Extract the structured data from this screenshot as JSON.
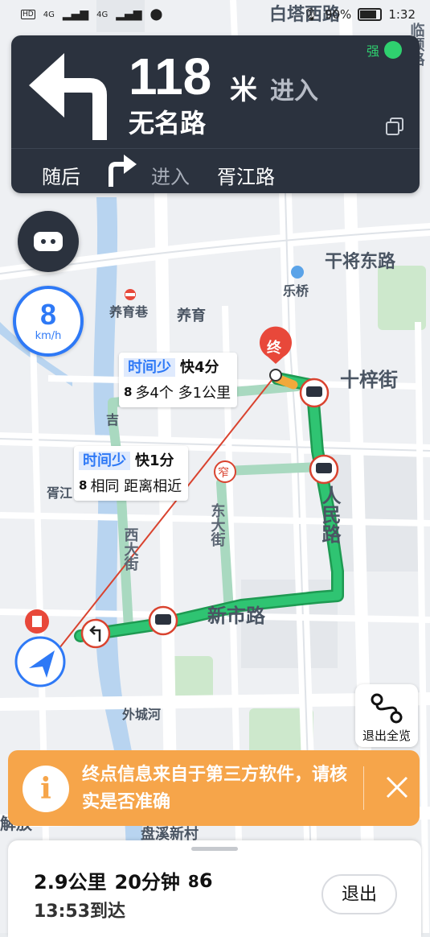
{
  "status_bar": {
    "left_labels": [
      "HD",
      "4G",
      "4G"
    ],
    "battery": "90%",
    "time": "1:32"
  },
  "navigation": {
    "distance": "118",
    "unit": "米",
    "action": "进入",
    "road": "无名路",
    "signal_label": "强",
    "then_label": "随后",
    "then_action": "进入",
    "then_road": "胥江路"
  },
  "speed": {
    "value": "8",
    "unit": "km/h"
  },
  "map_labels": {
    "baita": "白塔西路",
    "lin": "临顿路",
    "ganjiang": "干将东路",
    "leqiao": "乐桥",
    "yangyuxiang": "养育巷",
    "yangyu": "养育",
    "shizijie": "十梓街",
    "renminlu": "人民路",
    "xinshilu": "新市路",
    "xidajie": "西大街",
    "dongdajie": "东大街",
    "waichenghe": "外城河",
    "xujiang": "胥江",
    "jiefang": "解放",
    "panxi": "盘溪新村",
    "ji": "吉",
    "end_marker": "终",
    "narrow": "窄"
  },
  "route_tags": [
    {
      "label": "时间少",
      "fast": "快4分",
      "line2": "多4个 多1公里"
    },
    {
      "label": "时间少",
      "fast": "快1分",
      "line2": "相同 距离相近"
    }
  ],
  "exit_overview": "退出全览",
  "notice": {
    "icon": "i",
    "text": "终点信息来自于第三方软件，请核实是否准确"
  },
  "summary": {
    "distance": "2.9公里",
    "time": "20分钟",
    "lights": "6",
    "arrival": "13:53到达",
    "exit": "退出"
  },
  "colors": {
    "route": "#28b862",
    "nav_bg": "#2b323e",
    "accent_blue": "#2e79f6",
    "notice": "#f6a54a",
    "marker_red": "#e8483a"
  }
}
